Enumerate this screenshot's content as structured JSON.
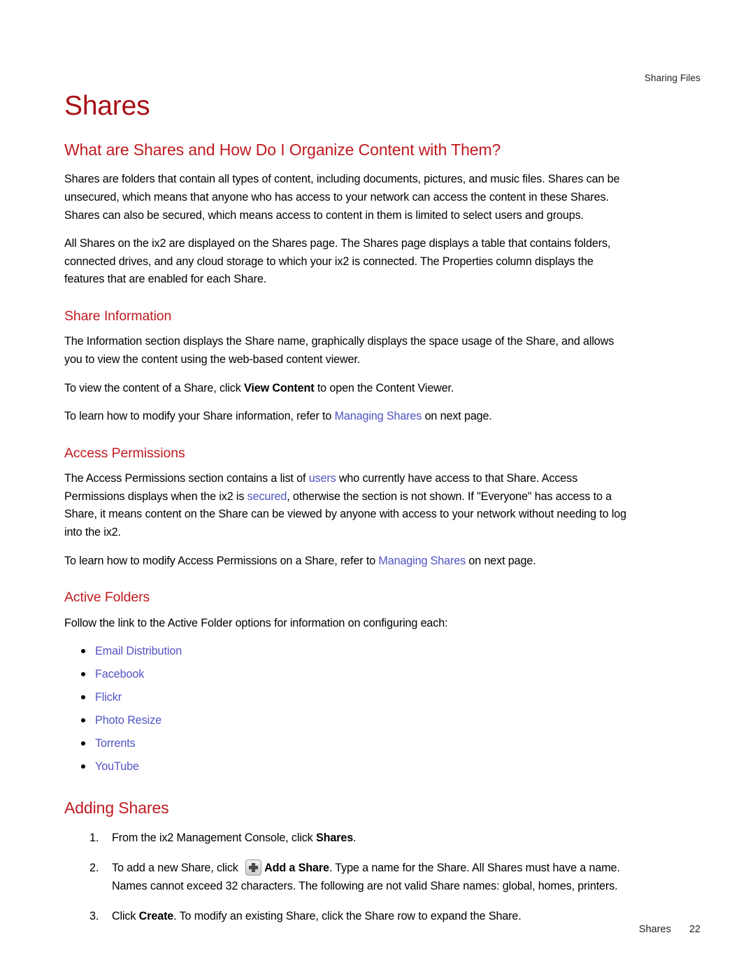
{
  "colors": {
    "heading_red": "#bf1a1f",
    "title_red": "#a81016",
    "link_blue": "#5252c4",
    "body_black": "#000000"
  },
  "running_header": "Sharing Files",
  "doc_title": "Shares",
  "sections": {
    "what_are_shares": {
      "heading": "What are Shares and How Do I Organize Content with Them?",
      "paragraph_1": "Shares are folders that contain all types of content, including documents, pictures, and music files. Shares can be unsecured, which means that anyone who has access to your network can access the content in these Shares. Shares can also be secured, which means access to content in them is limited to select users and groups.",
      "paragraph_2": "All Shares on the ix2 are displayed on the Shares page. The Shares page displays a table that contains folders, connected drives, and any cloud storage to which your ix2 is connected. The Properties column displays the features that are enabled for each Share."
    },
    "share_information": {
      "heading": "Share Information",
      "paragraph_1": "The Information section displays the Share name, graphically displays the space usage of the Share, and allows you to view the content using the web-based content viewer.",
      "paragraph_2_part_1": "To view the content of a Share, click ",
      "paragraph_2_bold": "View Content",
      "paragraph_2_part_2": " to open the Content Viewer.",
      "paragraph_3_part_1": "To learn how to modify your Share information, refer to ",
      "paragraph_3_link": "Managing Shares",
      "paragraph_3_part_2": " on next page."
    },
    "access_permissions": {
      "heading": "Access Permissions",
      "paragraph_1_part_1": "The Access Permissions section contains a list of ",
      "paragraph_1_link_1": "users",
      "paragraph_1_part_2": " who currently have access to that Share. Access Permissions displays when the ix2 is ",
      "paragraph_1_link_2": "secured",
      "paragraph_1_part_3": ", otherwise the section is not shown. If \"Everyone\" has access to a Share, it means content on the Share can be viewed by anyone with access to your network without needing to log into the ix2.",
      "paragraph_2_part_1": "To learn how to modify Access Permissions on a Share, refer to ",
      "paragraph_2_link": "Managing Shares",
      "paragraph_2_part_2": " on next page."
    },
    "active_folders": {
      "heading": "Active Folders",
      "intro": "Follow the link to the Active Folder options for information on configuring each:",
      "links": [
        "Email Distribution",
        "Facebook",
        "Flickr",
        "Photo Resize",
        "Torrents",
        "YouTube"
      ]
    },
    "adding_shares": {
      "heading": "Adding Shares",
      "steps": [
        {
          "number": "1.",
          "part_1": "From the ix2 Management Console, click ",
          "bold_1": "Shares",
          "part_2": ".",
          "has_icon": false
        },
        {
          "number": "2.",
          "part_1": "To add a new Share, click ",
          "icon": "plus-icon",
          "bold_1": "Add a Share",
          "part_2": ". Type a name for the Share. All Shares must have a name. Names cannot exceed 32 characters. The following are not valid Share names: global, homes, printers.",
          "has_icon": true
        },
        {
          "number": "3.",
          "part_1": "Click ",
          "bold_1": "Create",
          "part_2": ". To modify an existing Share, click the Share row to expand the Share.",
          "has_icon": false
        }
      ]
    }
  },
  "footer": {
    "label": "Shares",
    "page_number": "22"
  }
}
